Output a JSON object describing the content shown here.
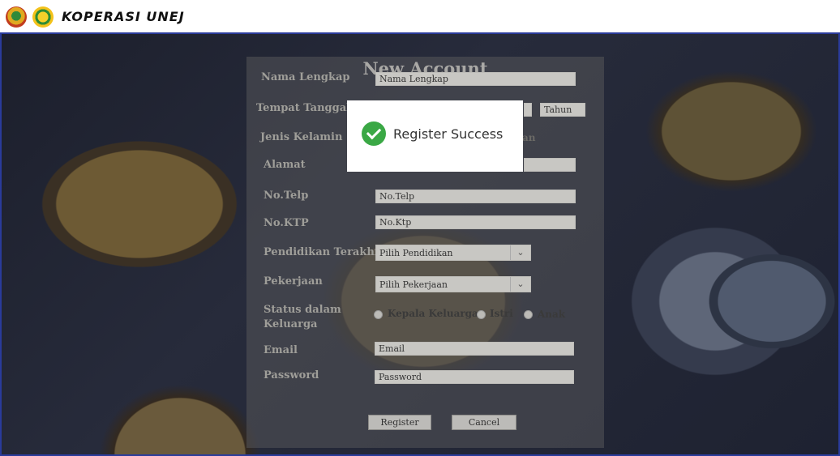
{
  "brand": {
    "name": "KOPERASI UNEJ"
  },
  "form": {
    "title": "New Account",
    "labels": {
      "nama": "Nama Lengkap",
      "ttl": "Tempat Tanggal Lahir",
      "jenis_kelamin": "Jenis Kelamin",
      "alamat": "Alamat",
      "telp": "No.Telp",
      "ktp": "No.KTP",
      "pendidikan": "Pendidikan Terakhir",
      "pekerjaan": "Pekerjaan",
      "status_line1": "Status dalam",
      "status_line2": "Keluarga",
      "email": "Email",
      "password": "Password"
    },
    "fields": {
      "nama": "Nama Lengkap",
      "tahun": "Tahun",
      "jenis_kelamin_opt_partial": "an",
      "telp": "No.Telp",
      "ktp": "No.Ktp",
      "email": "Email",
      "password": "Password"
    },
    "selects": {
      "pendidikan": "Pilih Pendidikan",
      "pekerjaan": "Pilih Pekerjaan"
    },
    "status_options": [
      "Kepala Keluarga",
      "Istri",
      "Anak"
    ],
    "buttons": {
      "register": "Register",
      "cancel": "Cancel"
    }
  },
  "dialog": {
    "message": "Register Success",
    "icon": "check-circle-icon"
  },
  "colors": {
    "accent_border": "#2a3b9a",
    "success": "#3aa845"
  }
}
